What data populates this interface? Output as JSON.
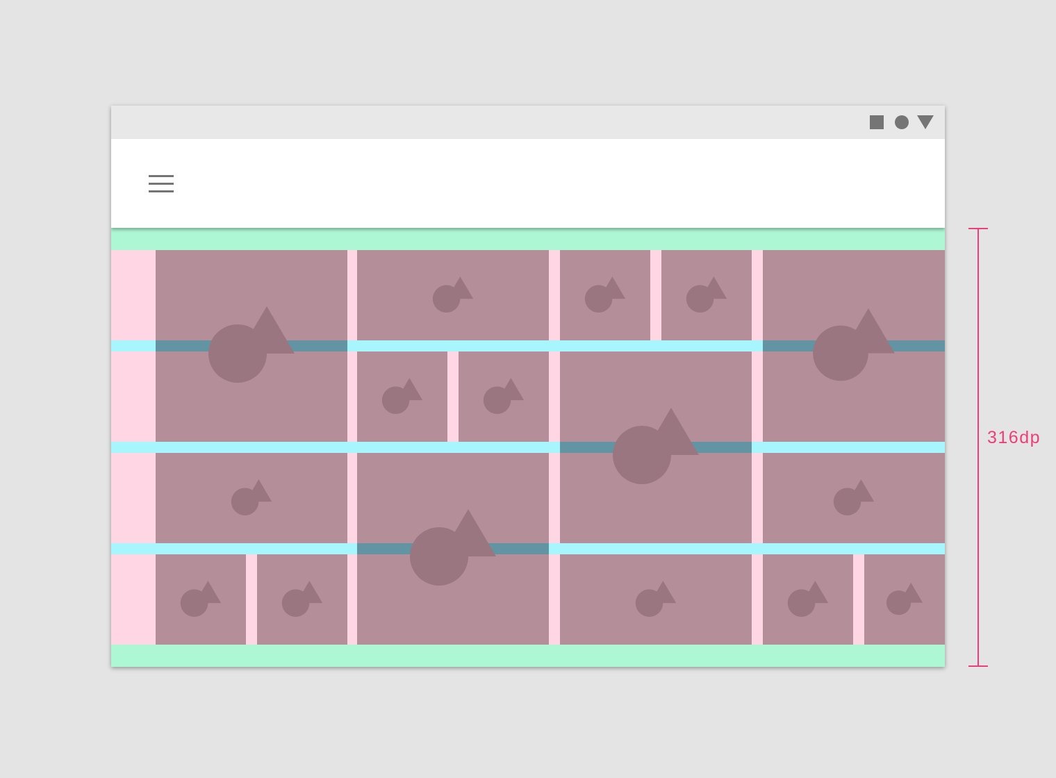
{
  "annotation": {
    "height_label": "316dp"
  },
  "colors": {
    "background": "#e4e4e4",
    "status_bar": "#e8e8e8",
    "app_bar": "#ffffff",
    "margin": "#adf7d4",
    "gutter": "#a8f6fd",
    "column_gutter": "#ffd7e4",
    "tile": "#b48e99",
    "tile_graphic": "#9a7680",
    "annotation": "#ee3d7a",
    "icon": "#757575"
  },
  "icons": {
    "status_bar": [
      "square-icon",
      "circle-icon",
      "triangle-down-icon"
    ],
    "app_bar": "menu-icon",
    "tile_placeholder": "image-placeholder-icon"
  }
}
